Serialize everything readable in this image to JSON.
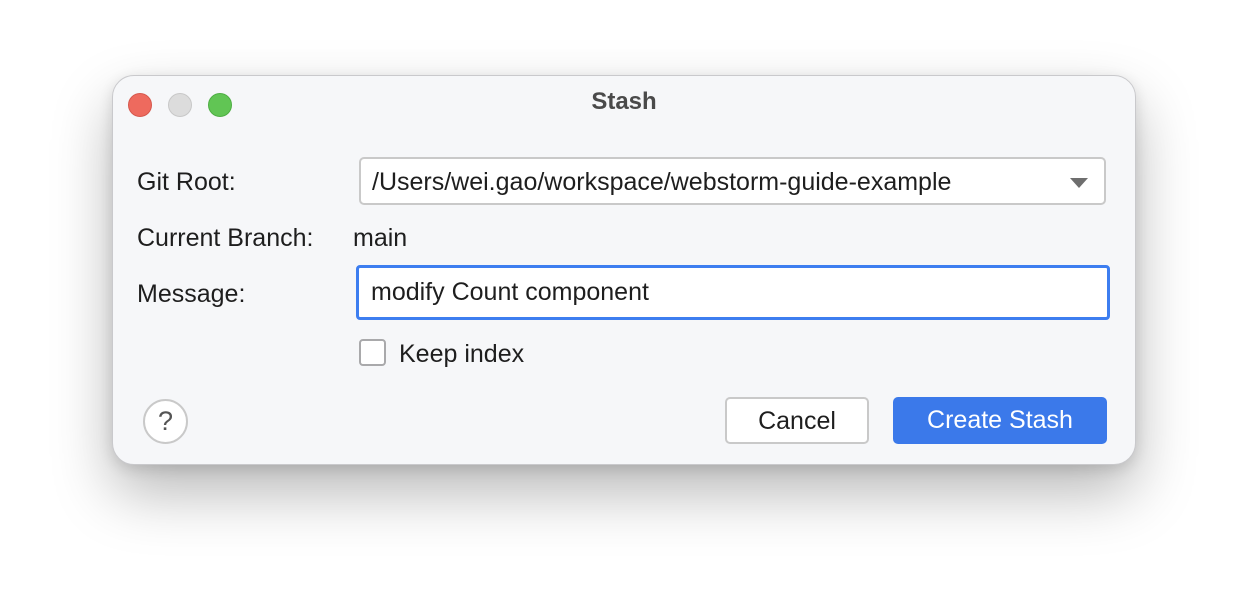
{
  "window": {
    "title": "Stash"
  },
  "form": {
    "git_root_label": "Git Root:",
    "git_root_value": "/Users/wei.gao/workspace/webstorm-guide-example",
    "current_branch_label": "Current Branch:",
    "current_branch_value": "main",
    "message_label": "Message:",
    "message_value": "modify Count component",
    "keep_index_label": "Keep index",
    "keep_index_checked": false
  },
  "buttons": {
    "help_glyph": "?",
    "cancel_label": "Cancel",
    "create_label": "Create Stash"
  },
  "colors": {
    "primary_button": "#3b79ea",
    "focus_border": "#3d7ef0",
    "close": "#ee6a5e",
    "minimize_inactive": "#dcdcdc",
    "maximize": "#61c554"
  },
  "icons": {
    "dropdown": "chevron-down-icon",
    "help": "help-icon"
  }
}
